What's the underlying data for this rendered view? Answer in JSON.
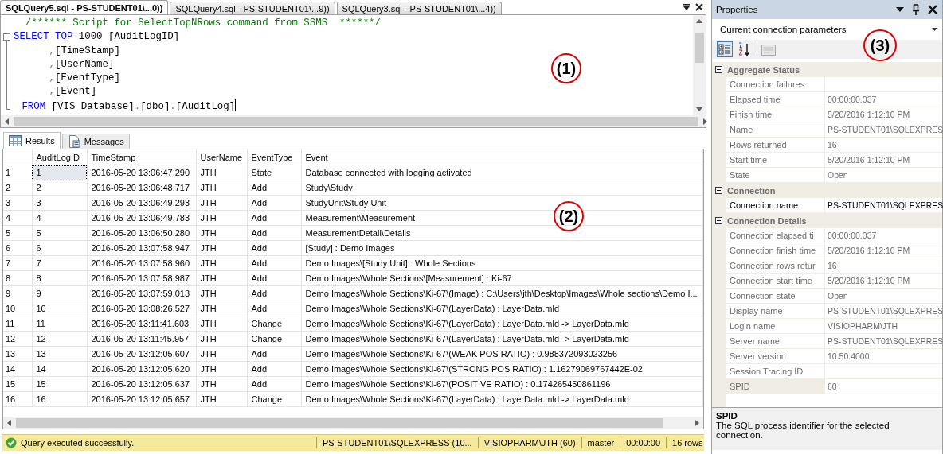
{
  "editor": {
    "tabs": [
      {
        "label": "SQLQuery5.sql - PS-STUDENT01\\...0))",
        "selected": true
      },
      {
        "label": "SQLQuery4.sql - PS-STUDENT01\\...9))",
        "selected": false
      },
      {
        "label": "SQLQuery3.sql - PS-STUDENT01\\...4))",
        "selected": false
      }
    ],
    "lines": [
      {
        "kind": "comment",
        "tokens": [
          {
            "kind": "comment",
            "text": "/****** Script for SelectTopNRows command from SSMS  ******/"
          }
        ]
      },
      {
        "kind": "statement",
        "tokens": [
          {
            "kind": "keyword",
            "text": "SELECT TOP "
          },
          {
            "kind": "plain",
            "text": "1000 [AuditLogID]"
          }
        ]
      },
      {
        "kind": "column",
        "tokens": [
          {
            "kind": "punct",
            "text": ","
          },
          {
            "kind": "plain",
            "text": "[TimeStamp]"
          }
        ]
      },
      {
        "kind": "column",
        "tokens": [
          {
            "kind": "punct",
            "text": ","
          },
          {
            "kind": "plain",
            "text": "[UserName]"
          }
        ]
      },
      {
        "kind": "column",
        "tokens": [
          {
            "kind": "punct",
            "text": ","
          },
          {
            "kind": "plain",
            "text": "[EventType]"
          }
        ]
      },
      {
        "kind": "column",
        "tokens": [
          {
            "kind": "punct",
            "text": ","
          },
          {
            "kind": "plain",
            "text": "[Event]"
          }
        ]
      },
      {
        "kind": "clause",
        "tokens": [
          {
            "kind": "keyword",
            "text": "FROM "
          },
          {
            "kind": "plain",
            "text": "[VIS Database]"
          },
          {
            "kind": "punct",
            "text": "."
          },
          {
            "kind": "plain",
            "text": "[dbo]"
          },
          {
            "kind": "punct",
            "text": "."
          },
          {
            "kind": "plain",
            "text": "[AuditLog]"
          }
        ]
      }
    ],
    "annotation": "(1)"
  },
  "results": {
    "tabs": [
      {
        "label": "Results",
        "selected": true
      },
      {
        "label": "Messages",
        "selected": false
      }
    ],
    "columns": [
      "AuditLogID",
      "TimeStamp",
      "UserName",
      "EventType",
      "Event"
    ],
    "rows": [
      {
        "num": "1",
        "cells": [
          "1",
          "2016-05-20 13:06:47.290",
          "JTH",
          "State",
          "Database connected with logging activated"
        ],
        "focused": true
      },
      {
        "num": "2",
        "cells": [
          "2",
          "2016-05-20 13:06:48.717",
          "JTH",
          "Add",
          "Study\\Study"
        ],
        "focused": false
      },
      {
        "num": "3",
        "cells": [
          "3",
          "2016-05-20 13:06:49.293",
          "JTH",
          "Add",
          "StudyUnit\\Study Unit"
        ],
        "focused": false
      },
      {
        "num": "4",
        "cells": [
          "4",
          "2016-05-20 13:06:49.783",
          "JTH",
          "Add",
          "Measurement\\Measurement"
        ],
        "focused": false
      },
      {
        "num": "5",
        "cells": [
          "5",
          "2016-05-20 13:06:50.280",
          "JTH",
          "Add",
          "MeasurementDetail\\Details"
        ],
        "focused": false
      },
      {
        "num": "6",
        "cells": [
          "6",
          "2016-05-20 13:07:58.947",
          "JTH",
          "Add",
          "[Study] : Demo Images"
        ],
        "focused": false
      },
      {
        "num": "7",
        "cells": [
          "7",
          "2016-05-20 13:07:58.960",
          "JTH",
          "Add",
          "Demo Images\\[Study Unit] : Whole Sections"
        ],
        "focused": false
      },
      {
        "num": "8",
        "cells": [
          "8",
          "2016-05-20 13:07:58.987",
          "JTH",
          "Add",
          "Demo Images\\Whole Sections\\[Measurement] : Ki-67"
        ],
        "focused": false
      },
      {
        "num": "9",
        "cells": [
          "9",
          "2016-05-20 13:07:59.013",
          "JTH",
          "Add",
          "Demo Images\\Whole Sections\\Ki-67\\(Image) : C:\\Users\\jth\\Desktop\\Images\\Whole sections\\Demo I..."
        ],
        "focused": false
      },
      {
        "num": "10",
        "cells": [
          "10",
          "2016-05-20 13:08:26.527",
          "JTH",
          "Add",
          "Demo Images\\Whole Sections\\Ki-67\\(LayerData) : LayerData.mld"
        ],
        "focused": false
      },
      {
        "num": "11",
        "cells": [
          "11",
          "2016-05-20 13:11:41.603",
          "JTH",
          "Change",
          "Demo Images\\Whole Sections\\Ki-67\\(LayerData) : LayerData.mld -> LayerData.mld"
        ],
        "focused": false
      },
      {
        "num": "12",
        "cells": [
          "12",
          "2016-05-20 13:11:45.957",
          "JTH",
          "Change",
          "Demo Images\\Whole Sections\\Ki-67\\(LayerData) : LayerData.mld -> LayerData.mld"
        ],
        "focused": false
      },
      {
        "num": "13",
        "cells": [
          "13",
          "2016-05-20 13:12:05.607",
          "JTH",
          "Add",
          "Demo Images\\Whole Sections\\Ki-67\\(WEAK POS RATIO) : 0.988372093023256"
        ],
        "focused": false
      },
      {
        "num": "14",
        "cells": [
          "14",
          "2016-05-20 13:12:05.620",
          "JTH",
          "Add",
          "Demo Images\\Whole Sections\\Ki-67\\(STRONG POS RATIO) : 1.16279069767442E-02"
        ],
        "focused": false
      },
      {
        "num": "15",
        "cells": [
          "15",
          "2016-05-20 13:12:05.637",
          "JTH",
          "Add",
          "Demo Images\\Whole Sections\\Ki-67\\(POSITIVE RATIO) : 0.174265450861196"
        ],
        "focused": false
      },
      {
        "num": "16",
        "cells": [
          "16",
          "2016-05-20 13:12:05.657",
          "JTH",
          "Change",
          "Demo Images\\Whole Sections\\Ki-67\\(LayerData) : LayerData.mld -> LayerData.mld"
        ],
        "focused": false
      }
    ],
    "annotation": "(2)"
  },
  "status_bar": {
    "message": "Query executed successfully.",
    "fields": [
      "PS-STUDENT01\\SQLEXPRESS (10...",
      "VISIOPHARM\\JTH (60)",
      "master",
      "00:00:00",
      "16 rows"
    ]
  },
  "properties": {
    "title": "Properties",
    "object": "Current connection parameters",
    "annotation": "(3)",
    "categories": [
      {
        "name": "Aggregate Status",
        "expanded": true,
        "items": [
          {
            "name": "Connection failures",
            "value": "",
            "readonly": true,
            "selected": false
          },
          {
            "name": "Elapsed time",
            "value": "00:00:00.037",
            "readonly": true,
            "selected": false
          },
          {
            "name": "Finish time",
            "value": "5/20/2016 1:12:10 PM",
            "readonly": true,
            "selected": false
          },
          {
            "name": "Name",
            "value": "PS-STUDENT01\\SQLEXPRES",
            "readonly": true,
            "selected": false
          },
          {
            "name": "Rows returned",
            "value": "16",
            "readonly": true,
            "selected": false
          },
          {
            "name": "Start time",
            "value": "5/20/2016 1:12:10 PM",
            "readonly": true,
            "selected": false
          },
          {
            "name": "State",
            "value": "Open",
            "readonly": true,
            "selected": false
          }
        ]
      },
      {
        "name": "Connection",
        "expanded": true,
        "items": [
          {
            "name": "Connection name",
            "value": "PS-STUDENT01\\SQLEXPRES",
            "readonly": false,
            "selected": false
          }
        ]
      },
      {
        "name": "Connection Details",
        "expanded": true,
        "items": [
          {
            "name": "Connection elapsed ti",
            "value": "00:00:00.037",
            "readonly": true,
            "selected": false
          },
          {
            "name": "Connection finish time",
            "value": "5/20/2016 1:12:10 PM",
            "readonly": true,
            "selected": false
          },
          {
            "name": "Connection rows retur",
            "value": "16",
            "readonly": true,
            "selected": false
          },
          {
            "name": "Connection start time",
            "value": "5/20/2016 1:12:10 PM",
            "readonly": true,
            "selected": false
          },
          {
            "name": "Connection state",
            "value": "Open",
            "readonly": true,
            "selected": false
          },
          {
            "name": "Display name",
            "value": "PS-STUDENT01\\SQLEXPRES",
            "readonly": true,
            "selected": false
          },
          {
            "name": "Login name",
            "value": "VISIOPHARM\\JTH",
            "readonly": true,
            "selected": false
          },
          {
            "name": "Server name",
            "value": "PS-STUDENT01\\SQLEXPRES",
            "readonly": true,
            "selected": false
          },
          {
            "name": "Server version",
            "value": "10.50.4000",
            "readonly": true,
            "selected": false
          },
          {
            "name": "Session Tracing ID",
            "value": "",
            "readonly": true,
            "selected": false
          },
          {
            "name": "SPID",
            "value": "60",
            "readonly": true,
            "selected": true
          }
        ]
      }
    ],
    "description": {
      "title": "SPID",
      "text": "The SQL process identifier for the selected connection."
    }
  }
}
